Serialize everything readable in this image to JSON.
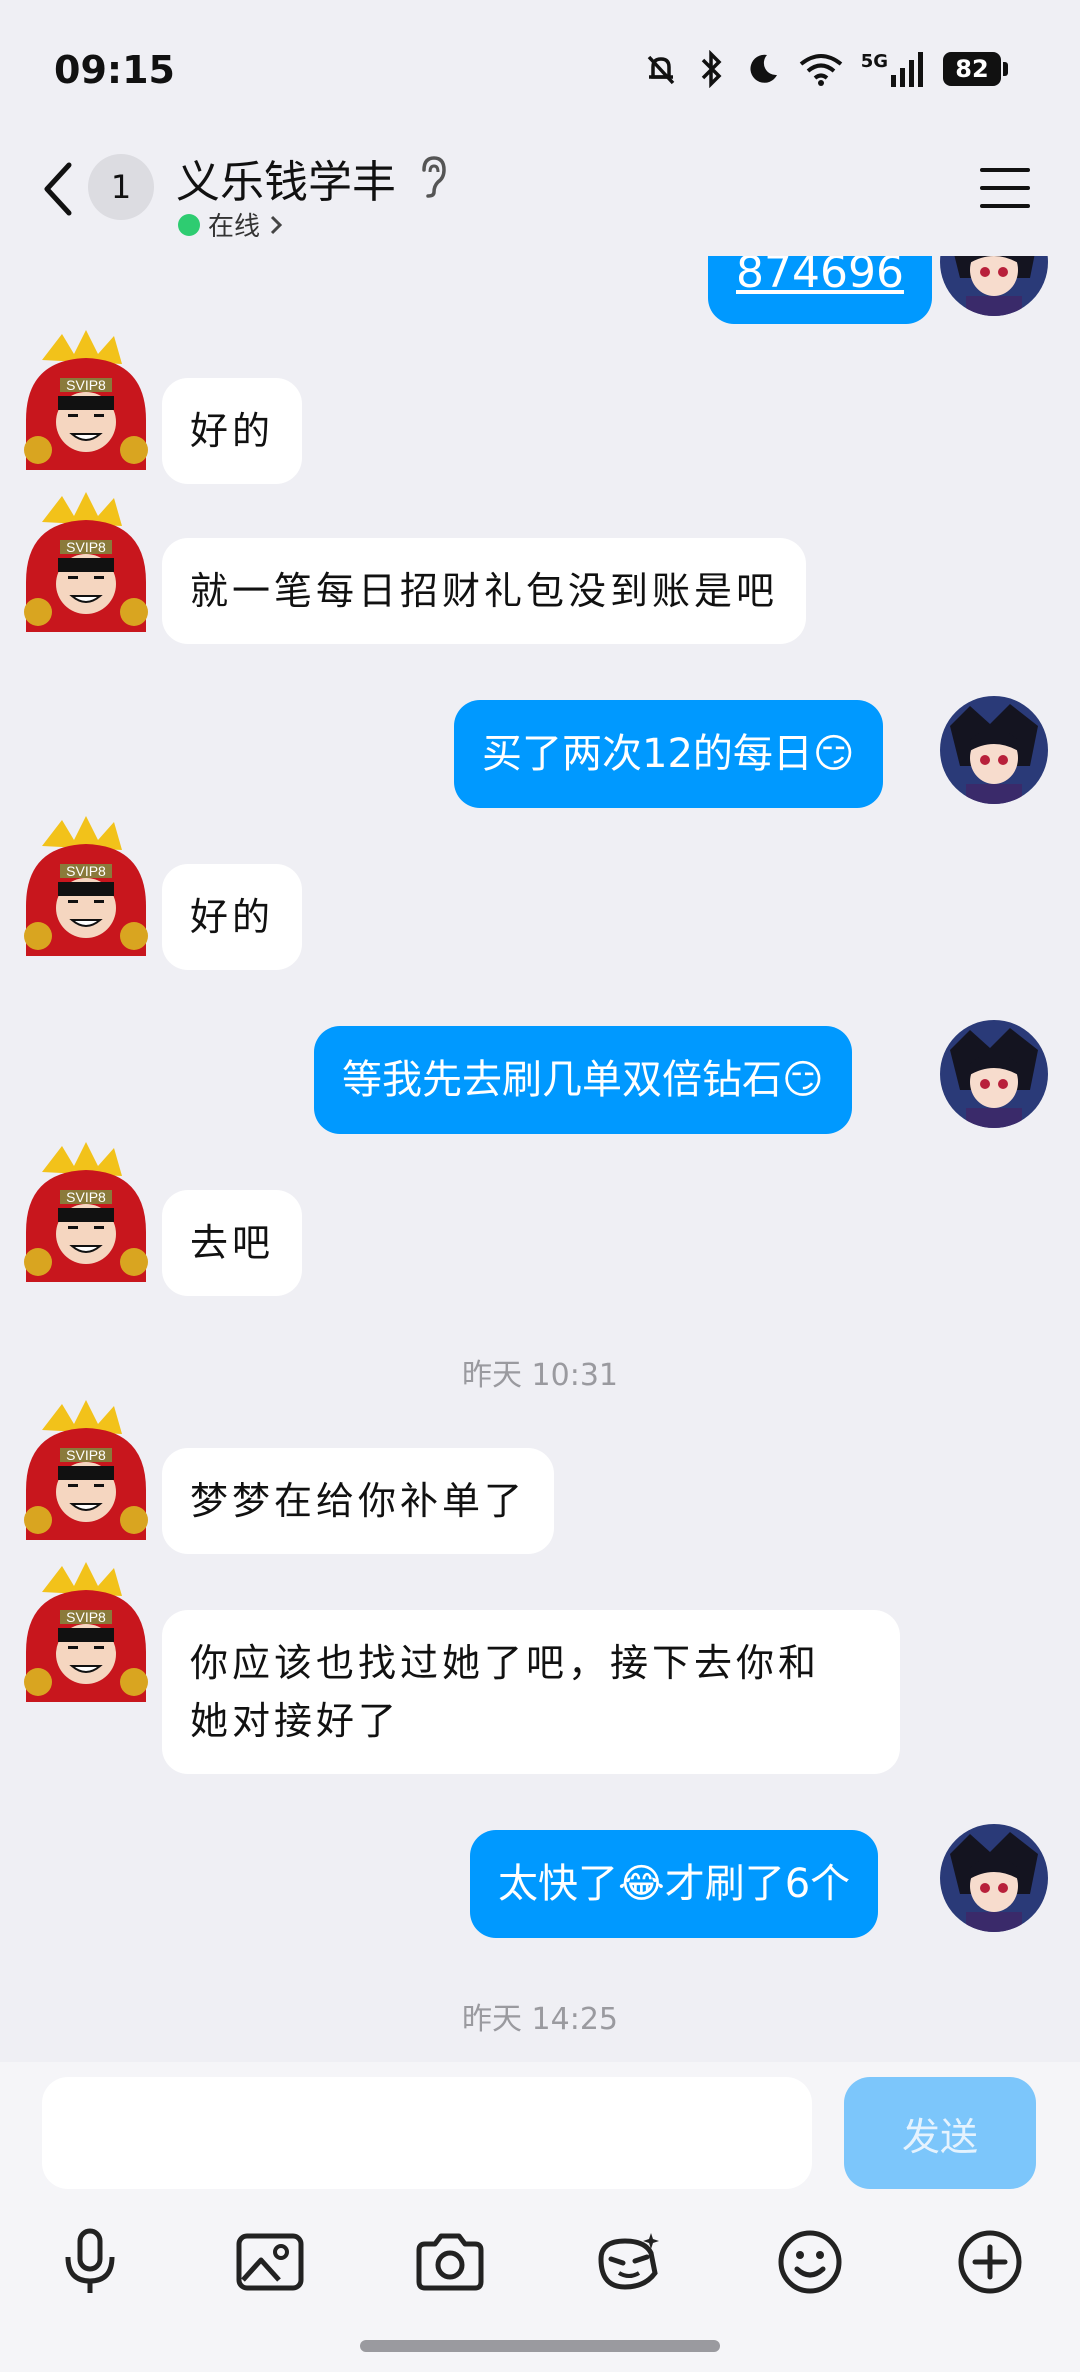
{
  "status_bar": {
    "time": "09:15",
    "network": "5G",
    "battery": "82"
  },
  "header": {
    "unread_count": "1",
    "title": "义乐钱学丰",
    "status": "在线"
  },
  "messages": {
    "m0": "874696",
    "m1": "好的",
    "m2": "就一笔每日招财礼包没到账是吧",
    "m3": "买了两次12的每日😏",
    "m4": "好的",
    "m5": "等我先去刷几单双倍钻石😏",
    "m6": "去吧",
    "t1": "昨天 10:31",
    "m7": "梦梦在给你补单了",
    "m8a": "你应该也找过她了吧，接下去你和",
    "m8b": "她对接好了",
    "m9": "太快了😂才刷了6个",
    "t2": "昨天 14:25"
  },
  "input": {
    "placeholder": "",
    "send_label": "发送"
  },
  "toolbar": {
    "icons": [
      "microphone-icon",
      "image-icon",
      "camera-icon",
      "sticker-icon",
      "emoji-icon",
      "plus-icon"
    ]
  },
  "colors": {
    "background": "#efeff4",
    "outgoing_bubble": "#0099ff",
    "incoming_bubble": "#ffffff",
    "send_button": "#7cc6fb",
    "online_dot": "#2ecc71"
  }
}
